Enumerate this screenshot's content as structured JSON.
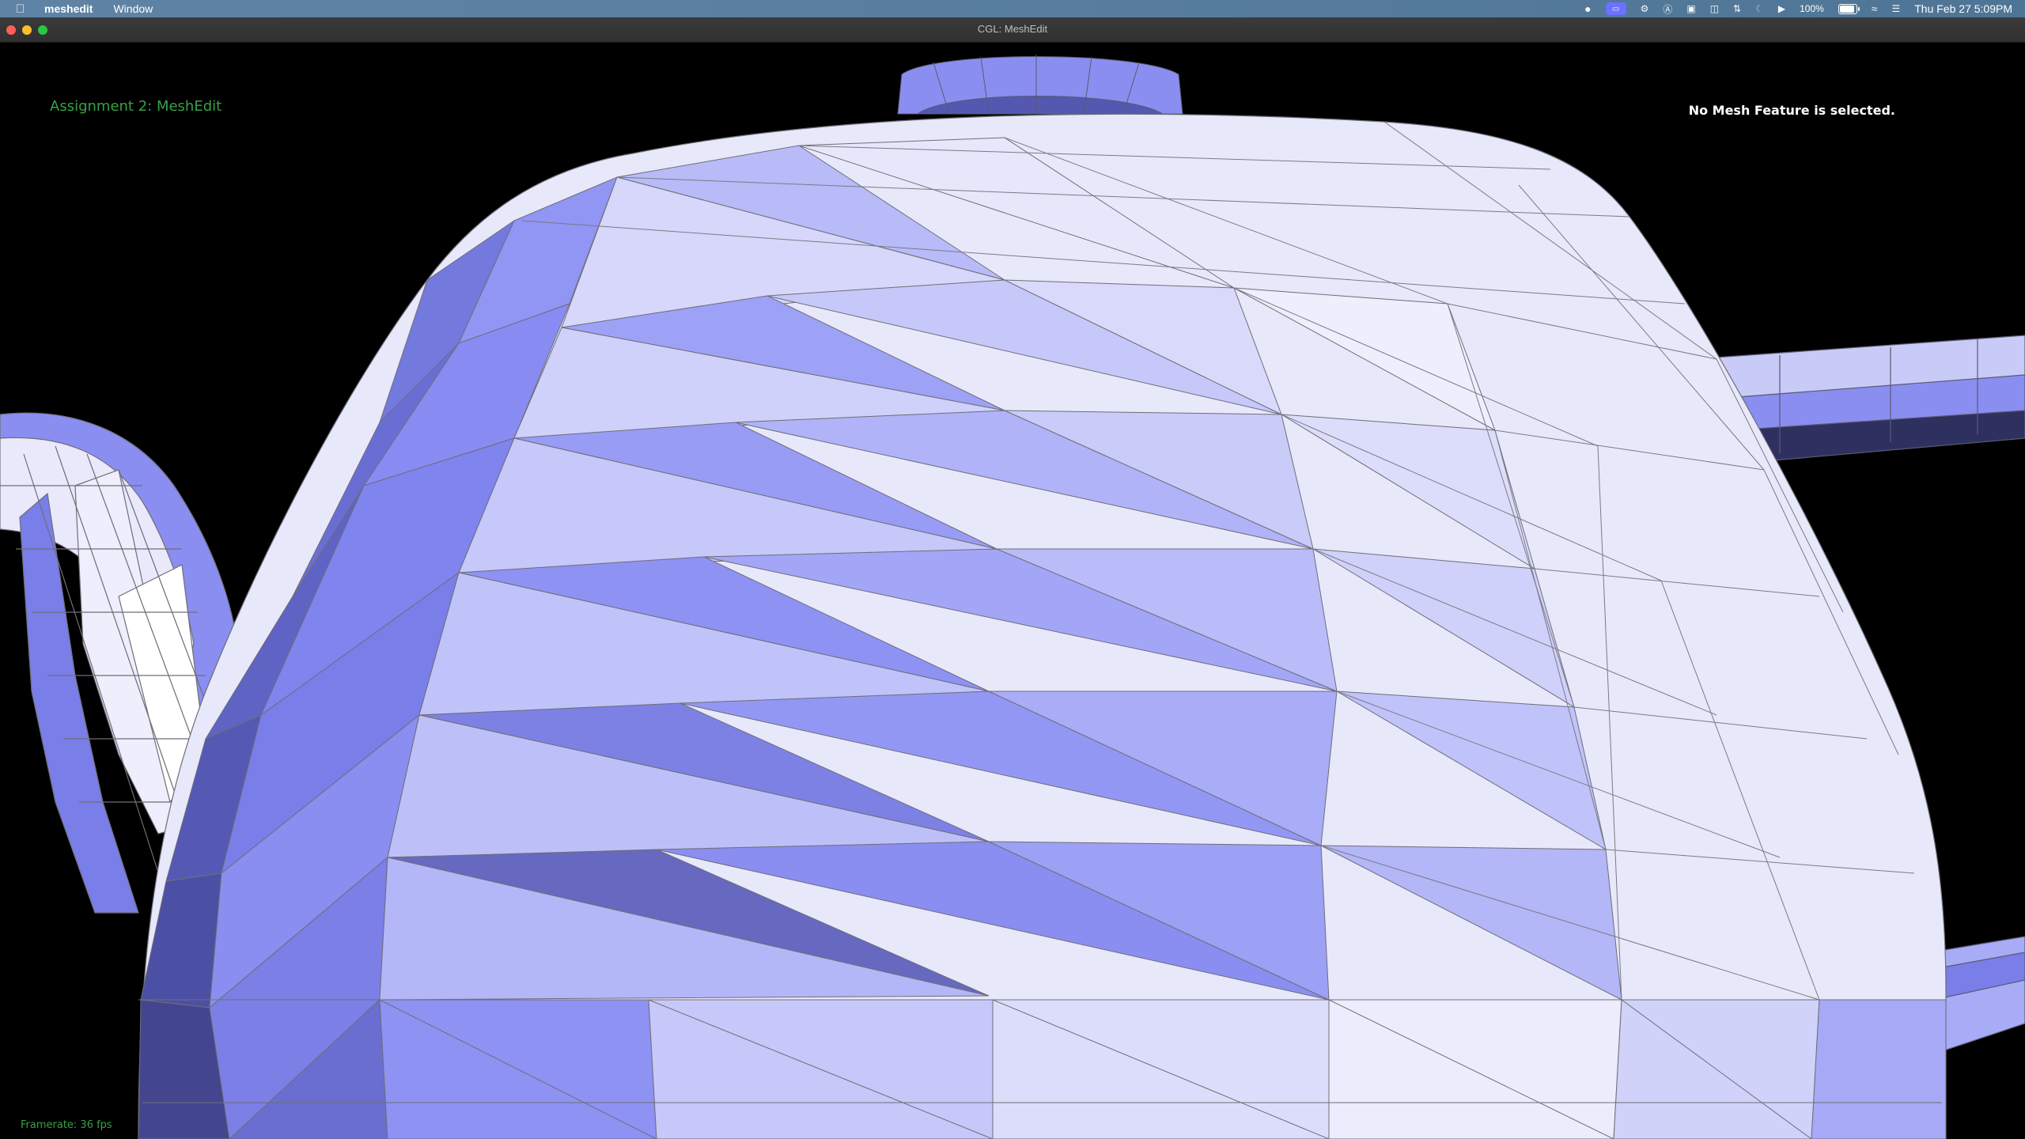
{
  "menubar": {
    "app_name": "meshedit",
    "menus": [
      "Window"
    ],
    "status": {
      "battery_percent_text": "100%",
      "battery_level": 1.0,
      "clock": "Thu Feb 27  5:09PM",
      "icons": [
        "record-icon",
        "screen-mirror-icon",
        "vpn-icon",
        "text-a-icon",
        "display-icon",
        "sidebar-icon",
        "bluetooth-like-icon",
        "moon-icon",
        "play-icon",
        "battery-icon",
        "wifi-icon",
        "control-center-icon"
      ]
    }
  },
  "window": {
    "title": "CGL: MeshEdit"
  },
  "hud": {
    "title": "Assignment 2: MeshEdit",
    "selection_status": "No Mesh Feature is selected.",
    "framerate": "Framerate: 36 fps"
  },
  "colors": {
    "hud_green": "#37a046",
    "mesh_light": "#ffffff",
    "mesh_mid": "#b9bcf8",
    "mesh_blue": "#8b90f5",
    "mesh_dark": "#5a5eb0",
    "wire": "#6e6e78"
  }
}
